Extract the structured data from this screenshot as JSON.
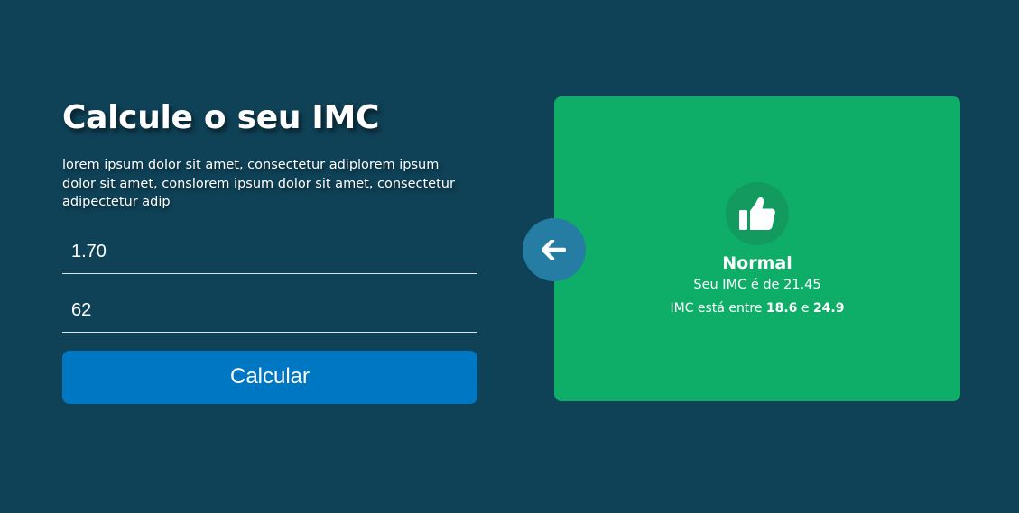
{
  "colors": {
    "background": "#0f4257",
    "button": "#0077c2",
    "result_card": "#0eae68",
    "result_icon_bg": "#139a5f",
    "back_button": "#257da3"
  },
  "form": {
    "title": "Calcule o seu IMC",
    "description": "lorem ipsum dolor sit amet, consectetur adiplorem ipsum dolor sit amet, conslorem ipsum dolor sit amet, consectetur adipectetur adip",
    "height_value": "1.70",
    "weight_value": "62",
    "calculate_label": "Calcular"
  },
  "back_button": {
    "icon": "arrow-left-icon"
  },
  "result": {
    "icon": "thumbs-up-icon",
    "status": "Normal",
    "imc_text": "Seu IMC é de 21.45",
    "range_prefix": "IMC está entre",
    "range_min": "18.6",
    "range_connector": "e",
    "range_max": "24.9"
  }
}
